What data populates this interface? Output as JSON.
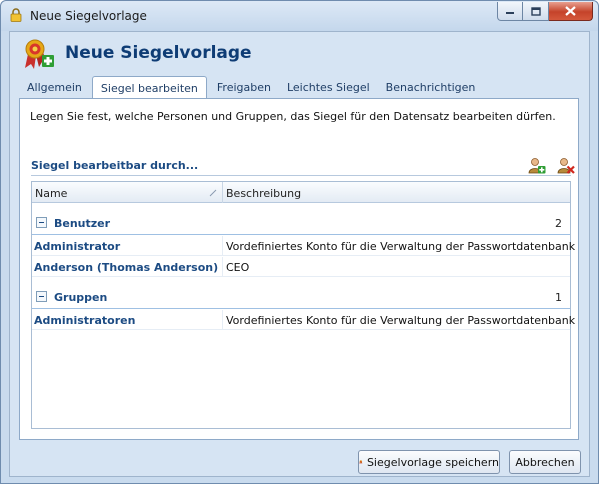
{
  "window": {
    "title": "Neue Siegelvorlage",
    "controls": {
      "minimize": "minimize-icon",
      "maximize": "maximize-icon",
      "close": "close-icon"
    }
  },
  "header": {
    "title": "Neue Siegelvorlage",
    "icon": "seal-add-icon"
  },
  "tabs": [
    {
      "label": "Allgemein",
      "active": false
    },
    {
      "label": "Siegel bearbeiten",
      "active": true
    },
    {
      "label": "Freigaben",
      "active": false
    },
    {
      "label": "Leichtes Siegel",
      "active": false
    },
    {
      "label": "Benachrichtigen",
      "active": false
    }
  ],
  "panel": {
    "intro": "Legen Sie fest, welche Personen und Gruppen, das Siegel für den Datensatz bearbeiten dürfen.",
    "section_title": "Siegel bearbeitbar durch...",
    "toolbar": {
      "add_icon": "add-user-icon",
      "remove_icon": "remove-user-icon"
    }
  },
  "grid": {
    "columns": [
      "Name",
      "Beschreibung"
    ],
    "groups": [
      {
        "label": "Benutzer",
        "count": "2",
        "rows": [
          {
            "name": "Administrator",
            "description": "Vordefiniertes Konto für die Verwaltung der Passwortdatenbank"
          },
          {
            "name": "Anderson (Thomas Anderson)",
            "description": "CEO"
          }
        ]
      },
      {
        "label": "Gruppen",
        "count": "1",
        "rows": [
          {
            "name": "Administratoren",
            "description": "Vordefiniertes Konto für die Verwaltung der Passwortdatenbank"
          }
        ]
      }
    ]
  },
  "footer": {
    "save_label": "Siegelvorlage speichern",
    "cancel_label": "Abbrechen"
  },
  "colors": {
    "accent": "#1c4b83",
    "frame": "#c9dbee",
    "close": "#c5432a"
  }
}
